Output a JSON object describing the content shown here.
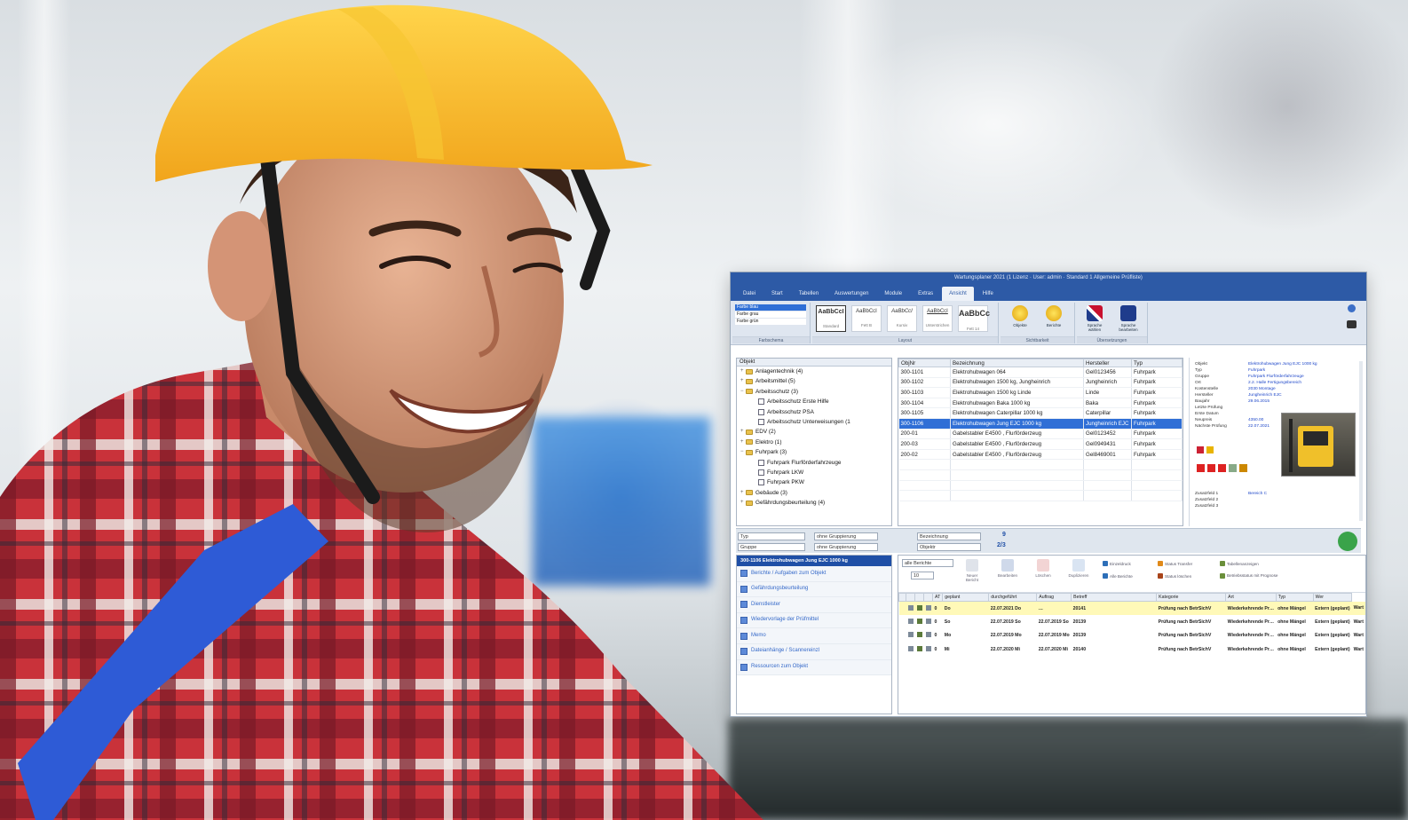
{
  "window": {
    "title": "Wartungsplaner 2021 (1 Lizenz · User: admin · Standard 1 Allgemeine Prüfliste)"
  },
  "menu": [
    "Datei",
    "Start",
    "Tabellen",
    "Auswertungen",
    "Module",
    "Extras",
    "Ansicht",
    "Hilfe"
  ],
  "menu_active": "Ansicht",
  "ribbon": {
    "theme_options": [
      "Farbe blau",
      "Farbe grau",
      "Farbe grün"
    ],
    "theme_group_label": "Farbschema",
    "styles": [
      {
        "preview": "AaBbCcI",
        "name": "Standard"
      },
      {
        "preview": "AaBbCcI",
        "name": "Fett B"
      },
      {
        "preview": "AaBbCcI",
        "name": "Kursiv"
      },
      {
        "preview": "AaBbCcI",
        "name": "Unterstrichen"
      },
      {
        "preview": "AaBbCc",
        "name": "Fett 14"
      }
    ],
    "layout_group_label": "Layout",
    "objects_button": "Objekte",
    "reports_button": "Berichte",
    "visibility_group_label": "Sichtbarkeit",
    "language_select_button": "Sprache wählen",
    "language_edit_button": "Sprache bearbeiten",
    "translations_group_label": "Übersetzungen"
  },
  "tree": {
    "header": "Objekt",
    "nodes": [
      {
        "label": "Anlagentechnik  (4)",
        "depth": 0,
        "type": "folder",
        "expander": "+"
      },
      {
        "label": "Arbeitsmittel  (5)",
        "depth": 0,
        "type": "folder",
        "expander": "+"
      },
      {
        "label": "Arbeitsschutz  (3)",
        "depth": 0,
        "type": "folder",
        "expander": "−"
      },
      {
        "label": "Arbeitsschutz Erste Hilfe",
        "depth": 1,
        "type": "leaf",
        "expander": ""
      },
      {
        "label": "Arbeitsschutz PSA",
        "depth": 1,
        "type": "leaf",
        "expander": ""
      },
      {
        "label": "Arbeitsschutz Unterweisungen (1",
        "depth": 1,
        "type": "leaf",
        "expander": ""
      },
      {
        "label": "EDV  (2)",
        "depth": 0,
        "type": "folder",
        "expander": "+"
      },
      {
        "label": "Elektro  (1)",
        "depth": 0,
        "type": "folder",
        "expander": "+"
      },
      {
        "label": "Fuhrpark  (3)",
        "depth": 0,
        "type": "folder",
        "expander": "−"
      },
      {
        "label": "Fuhrpark Flurförderfahrzeuge",
        "depth": 1,
        "type": "leaf",
        "expander": ""
      },
      {
        "label": "Fuhrpark LKW",
        "depth": 1,
        "type": "leaf",
        "expander": ""
      },
      {
        "label": "Fuhrpark PKW",
        "depth": 1,
        "type": "leaf",
        "expander": ""
      },
      {
        "label": "Gebäude  (3)",
        "depth": 0,
        "type": "folder",
        "expander": "+"
      },
      {
        "label": "Gefährdungsbeurteilung  (4)",
        "depth": 0,
        "type": "folder",
        "expander": "+"
      }
    ]
  },
  "grid": {
    "columns": [
      "ObjNr",
      "Bezeichnung",
      "Hersteller",
      "Typ"
    ],
    "rows": [
      [
        "300-1101",
        "Elektrohubwagen 064",
        "Gel0123456",
        "Fuhrpark"
      ],
      [
        "300-1102",
        "Elektrohubwagen 1500 kg, Jungheinrich",
        "Jungheinrich",
        "Fuhrpark"
      ],
      [
        "300-1103",
        "Elektrohubwagen 1500 kg Linde",
        "Linde",
        "Fuhrpark"
      ],
      [
        "300-1104",
        "Elektrohubwagen Baka 1000 kg",
        "Baka",
        "Fuhrpark"
      ],
      [
        "300-1105",
        "Elektrohubwagen Caterpillar 1000 kg",
        "Caterpillar",
        "Fuhrpark"
      ],
      [
        "300-1106",
        "Elektrohubwagen Jung EJC 1000 kg",
        "Jungheinrich EJC",
        "Fuhrpark"
      ],
      [
        "200-01",
        "Gabelstabler E4500 , Flurförderzeug",
        "Gel0123452",
        "Fuhrpark"
      ],
      [
        "200-03",
        "Gabelstabler E4500 , Flurförderzeug",
        "Gel0949431",
        "Fuhrpark"
      ],
      [
        "200-02",
        "Gabelstabler E4500 , Flurförderzeug",
        "Gel8469001",
        "Fuhrpark"
      ]
    ],
    "selected_index": 5
  },
  "details": {
    "fields": [
      {
        "k": "Objekt",
        "v": "Elektrohubwagen Jung EJC 1000 kg"
      },
      {
        "k": "Typ",
        "v": "Fuhrpark"
      },
      {
        "k": "Gruppe",
        "v": "Fuhrpark Flurförderfahrzeuge"
      },
      {
        "k": "Ort",
        "v": "2.2. Halle Fertigungsbereich"
      },
      {
        "k": "Kostenstelle",
        "v": "2030 Montage"
      },
      {
        "k": "Hersteller",
        "v": "Jungheinrich EJC"
      },
      {
        "k": "Baujahr",
        "v": "29.06.2015"
      },
      {
        "k": "Letzte Prüfung",
        "v": ""
      },
      {
        "k": "Erste Datum",
        "v": ""
      },
      {
        "k": "Neupreis",
        "v": "4350.00"
      },
      {
        "k": "Nächste Prüfung",
        "v": "22.07.2021"
      }
    ],
    "extra_fields": [
      {
        "k": "Zusatzfeld 1",
        "v": "Bereich C"
      },
      {
        "k": "Zusatzfeld 2",
        "v": ""
      },
      {
        "k": "Zusatzfeld 3",
        "v": ""
      }
    ]
  },
  "filters": {
    "left": [
      "Typ",
      "Gruppe"
    ],
    "left_values": [
      "ohne Gruppierung",
      "ohne Gruppierung"
    ],
    "right": [
      "Bezeichnung",
      "Objektr"
    ],
    "count_top": "9",
    "count_bottom": "2/3"
  },
  "sidepanel": {
    "title": "300-1106 Elektrohubwagen Jung EJC 1000 kg",
    "items": [
      "Berichte / Aufgaben zum Objekt",
      "Gefährdungsbeurteilung",
      "Dienstleister",
      "Wiedervorlage der Prüfmittel",
      "Memo",
      "Dateianhänge / Scannereinzl",
      "Ressourcen zum Objekt"
    ]
  },
  "tasks": {
    "filter": "alle Berichte",
    "count": "10",
    "toolbar": [
      "Neuer Bericht",
      "Bearbeiten",
      "Löschen",
      "Duplizieren"
    ],
    "small_actions": [
      "Einzeldruck",
      "Alle Berichte",
      "Status Transfer",
      "Status löschen",
      "Tabellenanzeigen",
      "Betriebsstatus mit Prognose"
    ],
    "columns": [
      "",
      "",
      "",
      "",
      "AT",
      "geplant",
      "durchgeführt",
      "Auftrag",
      "Betreff",
      "Kategorie",
      "Art",
      "Typ",
      "Wer"
    ],
    "rows": [
      [
        "0",
        "Do",
        "22.07.2021 Do",
        "…",
        "20141",
        "Prüfung nach BetrSichV",
        "Wiederkehrende Pr…",
        "ohne Mängel",
        "Extern (geplant)",
        "Wart"
      ],
      [
        "0",
        "So",
        "22.07.2019 So",
        "22.07.2019 So",
        "20139",
        "Prüfung nach BetrSichV",
        "Wiederkehrende Pr…",
        "ohne Mängel",
        "Extern (geplant)",
        "Wart"
      ],
      [
        "0",
        "Mo",
        "22.07.2019 Mo",
        "22.07.2019 Mo",
        "20139",
        "Prüfung nach BetrSichV",
        "Wiederkehrende Pr…",
        "ohne Mängel",
        "Extern (geplant)",
        "Wart"
      ],
      [
        "0",
        "Mi",
        "22.07.2020 Mi",
        "22.07.2020 Mi",
        "20140",
        "Prüfung nach BetrSichV",
        "Wiederkehrende Pr…",
        "ohne Mängel",
        "Extern (geplant)",
        "Wart"
      ]
    ]
  }
}
